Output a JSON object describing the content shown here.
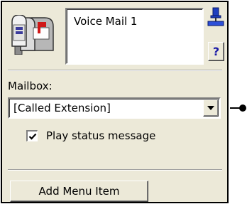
{
  "node": {
    "title": "Voice Mail 1",
    "icon": "mailbox-icon",
    "pin_icon": "pin-icon",
    "help_label": "?"
  },
  "mailbox": {
    "label": "Mailbox:",
    "selected": "[Called Extension]"
  },
  "status_message": {
    "label": "Play status message",
    "checked": true
  },
  "add_menu_item": {
    "label": "Add Menu Item"
  },
  "colors": {
    "panel_bg": "#ece9d8",
    "help_glyph": "#1a1aa6",
    "pin_blue": "#1f3fbf"
  }
}
